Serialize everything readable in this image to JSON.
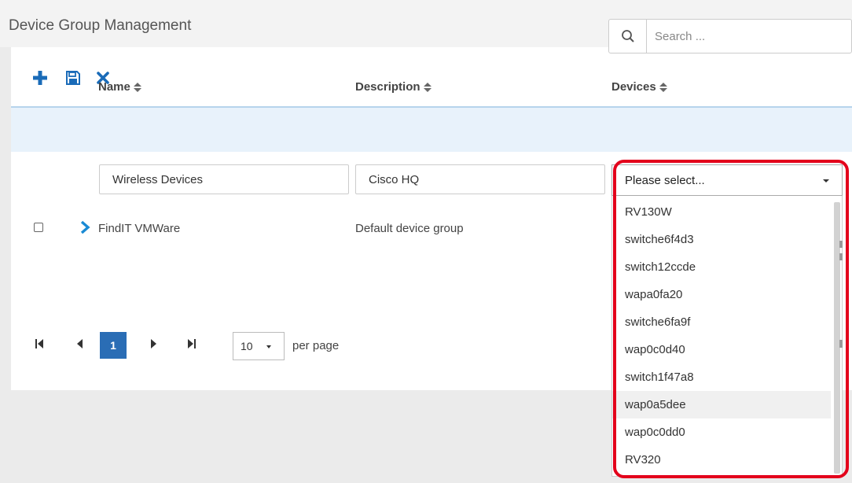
{
  "page": {
    "title": "Device Group Management"
  },
  "toolbar": {
    "add_icon": "plus-icon",
    "save_icon": "floppy-disk-icon",
    "delete_icon": "close-icon"
  },
  "search": {
    "placeholder": "Search ..."
  },
  "table": {
    "columns": [
      {
        "label": "Name"
      },
      {
        "label": "Description"
      },
      {
        "label": "Devices"
      }
    ],
    "edit_row": {
      "name": "Wireless Devices",
      "description": "Cisco HQ",
      "devices_placeholder": "Please select..."
    },
    "rows": [
      {
        "name": "FindIT VMWare",
        "description": "Default device group"
      }
    ]
  },
  "device_options": [
    "RV130W",
    "switche6f4d3",
    "switch12ccde",
    "wapa0fa20",
    "switche6fa9f",
    "wap0c0d40",
    "switch1f47a8",
    "wap0a5dee",
    "wap0c0dd0",
    "RV320"
  ],
  "device_highlighted": "wap0a5dee",
  "pagination": {
    "current_page": "1",
    "page_size": "10",
    "per_page_label": "per page"
  },
  "colors": {
    "accent": "#1a6bb8",
    "highlight_ring": "#e3001b",
    "edit_row_bg": "#e8f2fb"
  }
}
